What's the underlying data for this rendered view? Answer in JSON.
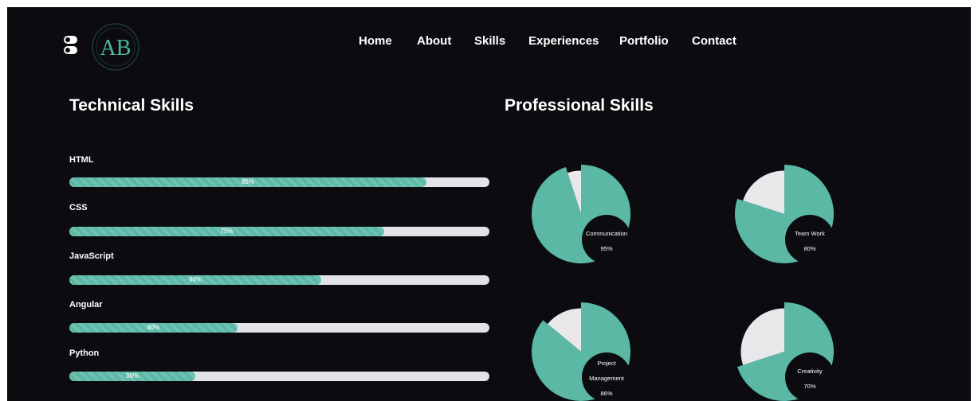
{
  "header": {
    "logo_text": "AB",
    "nav": [
      "Home",
      "About",
      "Skills",
      "Experiences",
      "Portfolio",
      "Contact"
    ]
  },
  "technical": {
    "title": "Technical Skills",
    "skills": [
      {
        "name": "HTML",
        "percent": 85,
        "label": "85%"
      },
      {
        "name": "CSS",
        "percent": 75,
        "label": "75%"
      },
      {
        "name": "JavaScript",
        "percent": 60,
        "label": "60%"
      },
      {
        "name": "Angular",
        "percent": 40,
        "label": "40%"
      },
      {
        "name": "Python",
        "percent": 30,
        "label": "30%"
      }
    ]
  },
  "professional": {
    "title": "Professional Skills",
    "skills": [
      {
        "name_lines": [
          "Communication"
        ],
        "percent": 95,
        "label": "95%"
      },
      {
        "name_lines": [
          "Team Work"
        ],
        "percent": 80,
        "label": "80%"
      },
      {
        "name_lines": [
          "Project",
          "Management"
        ],
        "percent": 86,
        "label": "86%"
      },
      {
        "name_lines": [
          "Creativity"
        ],
        "percent": 70,
        "label": "70%"
      }
    ]
  },
  "colors": {
    "background": "#0c0c10",
    "accent": "#5ab8a5",
    "track": "#e3e3e7",
    "text": "#ffffff"
  },
  "icons": {
    "theme_toggle": "toggle-icon",
    "logo": "ab-logo-icon"
  }
}
